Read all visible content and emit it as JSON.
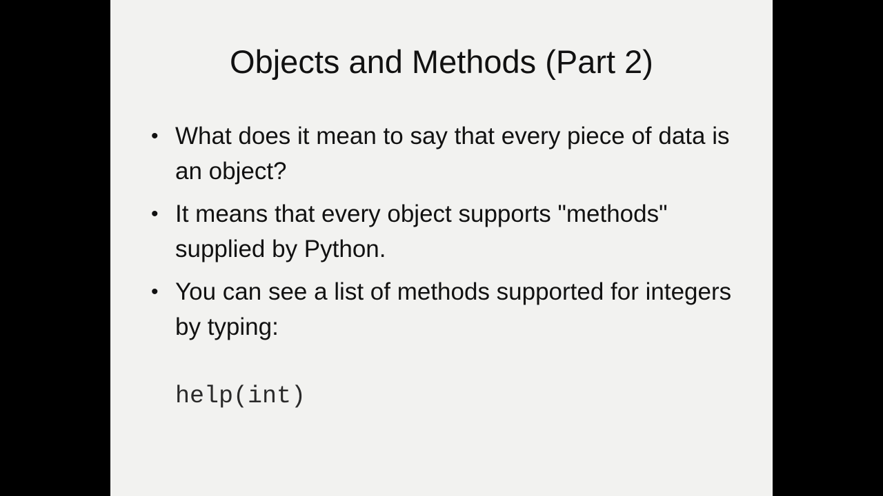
{
  "slide": {
    "title": "Objects and Methods (Part 2)",
    "bullets": [
      "What does it mean to say that every piece of data is an object?",
      "It means that every object supports \"methods\" supplied by Python.",
      "You can see a list of methods supported for integers by typing:"
    ],
    "code": "help(int)"
  },
  "colors": {
    "background": "#000000",
    "slide": "#f2f2f0",
    "text": "#111111"
  }
}
